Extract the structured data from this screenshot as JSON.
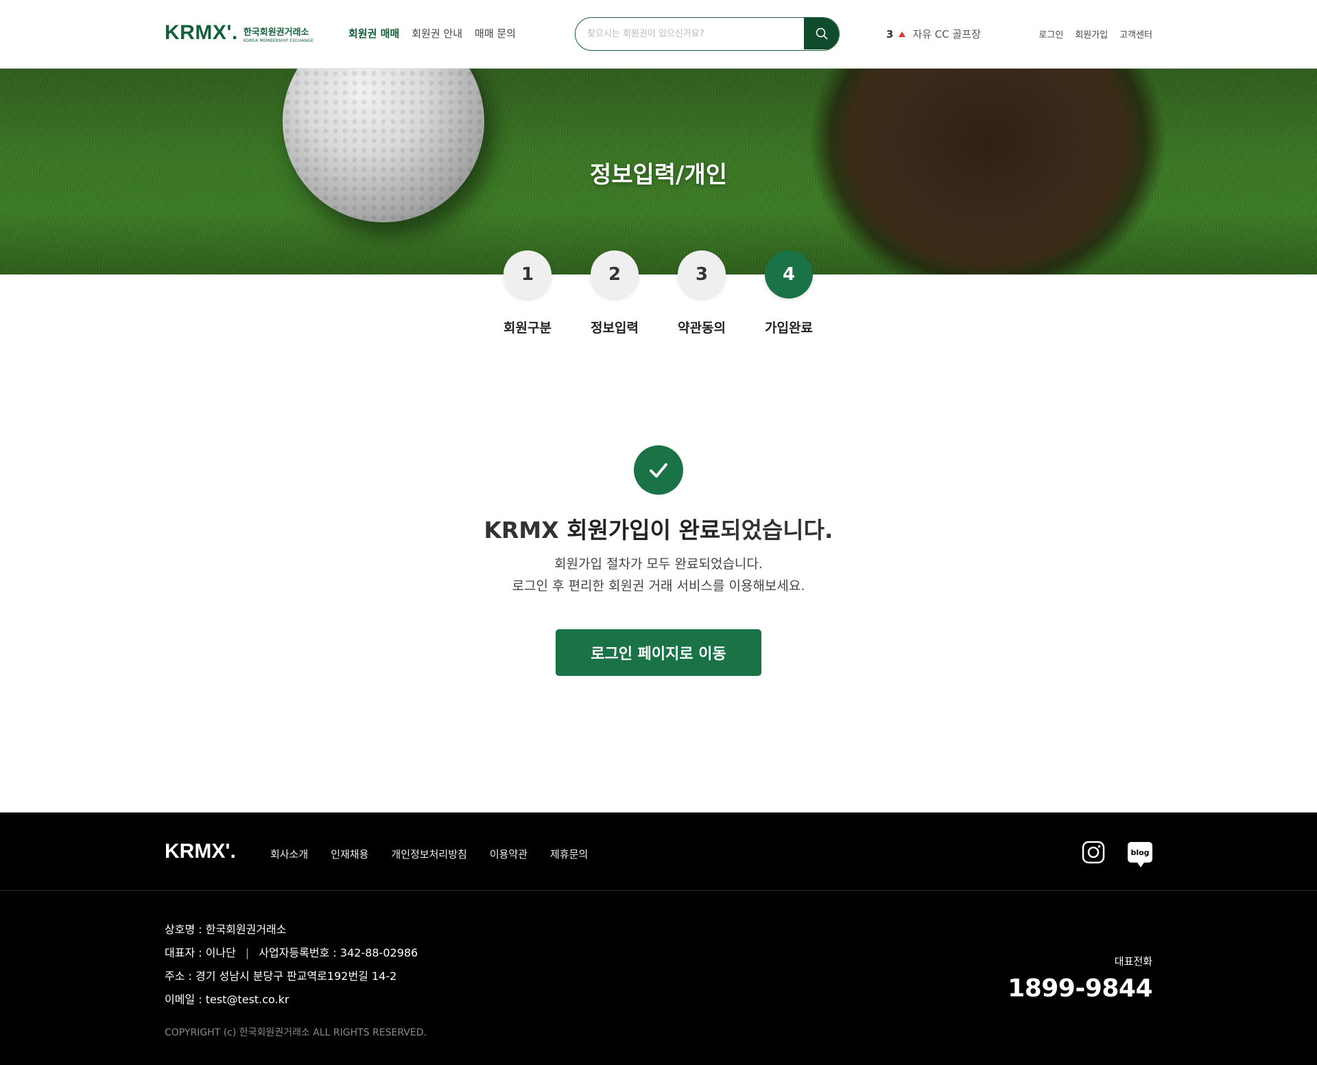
{
  "header": {
    "logo_mark": "KRMX'.",
    "logo_ko": "한국회원권거래소",
    "logo_en": "KOREA MEMBERSHIP EXCHANGE",
    "nav": [
      {
        "label": "회원권 매매",
        "active": true
      },
      {
        "label": "회원권 안내",
        "active": false
      },
      {
        "label": "매매 문의",
        "active": false
      }
    ],
    "search": {
      "placeholder": "찾으시는 회원권이 있으신가요?",
      "value": ""
    },
    "rank": {
      "number": "3",
      "trend": "up",
      "text": "자유 CC 골프장"
    },
    "util": [
      "로그인",
      "회원가입",
      "고객센터"
    ]
  },
  "hero": {
    "title": "정보입력/개인"
  },
  "steps": [
    {
      "number": "1",
      "label": "회원구분",
      "active": false
    },
    {
      "number": "2",
      "label": "정보입력",
      "active": false
    },
    {
      "number": "3",
      "label": "약관동의",
      "active": false
    },
    {
      "number": "4",
      "label": "가입완료",
      "active": true
    }
  ],
  "complete": {
    "title_prefix": "KRMX ",
    "title_bold": "회원가입이 완료",
    "title_suffix": "되었습니다.",
    "desc_line1": "회원가입 절차가 모두 완료되었습니다.",
    "desc_line2": "로그인 후 편리한 회원권 거래 서비스를 이용해보세요.",
    "button": "로그인 페이지로 이동"
  },
  "footer": {
    "logo": "KRMX'.",
    "nav": [
      "회사소개",
      "인재채용",
      "개인정보처리방침",
      "이용약관",
      "제휴문의"
    ],
    "sns": [
      "instagram-icon",
      "blog-icon"
    ],
    "blog_text": "blog",
    "company": "상호명 : 한국회원권거래소",
    "ceo": "대표자 : 이나단",
    "biz_no": "사업자등록번호 : 342-88-02986",
    "address": "주소 : 경기 성남시 분당구 판교역로192번길 14-2",
    "email": "이메일 : test@test.co.kr",
    "copyright": "COPYRIGHT (c) 한국회원권거래소 ALL RIGHTS RESERVED.",
    "tel_label": "대표전화",
    "tel": "1899-9844"
  },
  "colors": {
    "brand_green": "#1a7346",
    "dark_green": "#0f4b2c",
    "rank_up": "#e0352b",
    "footer_bg": "#000000"
  }
}
